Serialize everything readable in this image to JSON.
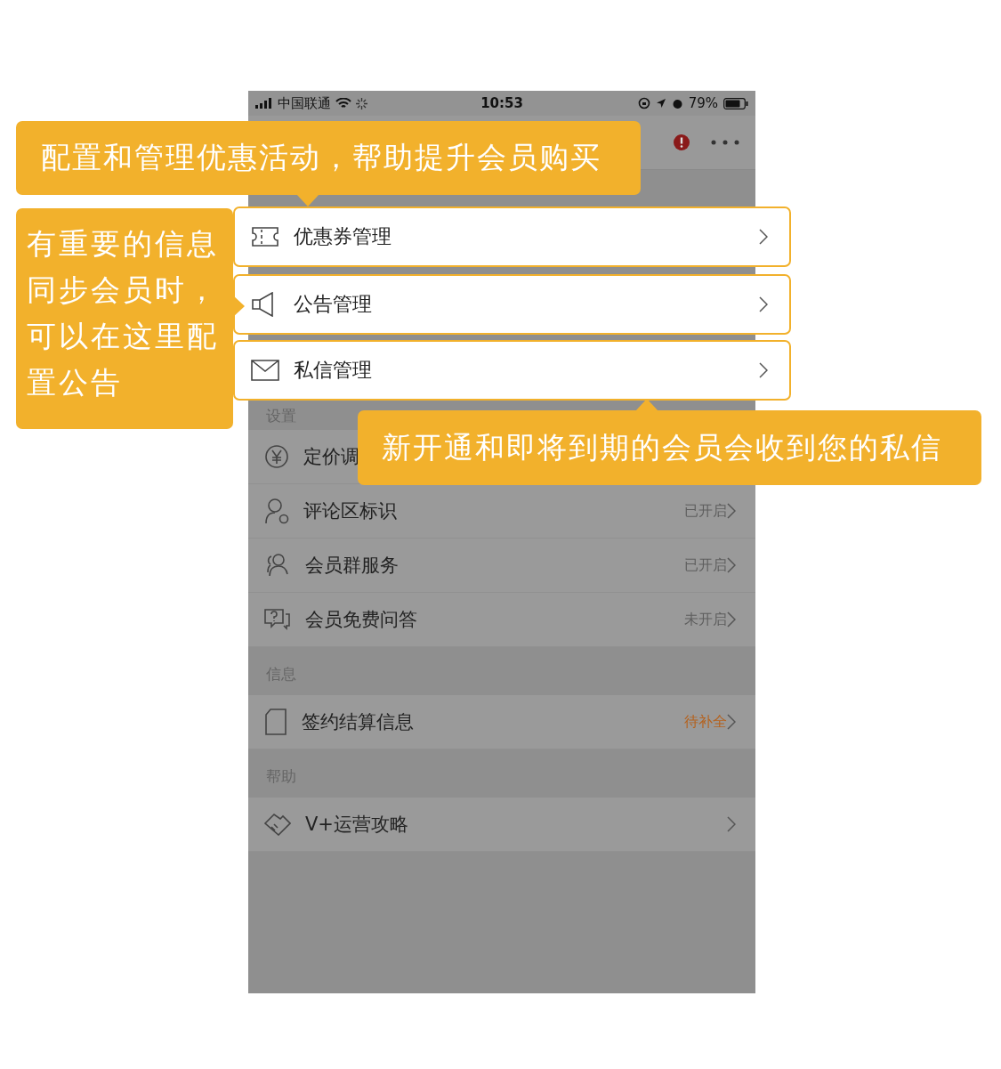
{
  "status_bar": {
    "carrier": "中国联通",
    "time": "10:53",
    "battery": "79%"
  },
  "highlighted_items": [
    {
      "kind": "coupon",
      "label": "优惠券管理"
    },
    {
      "kind": "announcement",
      "label": "公告管理"
    },
    {
      "kind": "message",
      "label": "私信管理"
    }
  ],
  "sections": [
    {
      "title": "设置",
      "items": [
        {
          "kind": "price",
          "label": "定价调"
        },
        {
          "kind": "comment",
          "label": "评论区标识",
          "status": "已开启",
          "attention": false
        },
        {
          "kind": "group",
          "label": "会员群服务",
          "status": "已开启",
          "attention": false
        },
        {
          "kind": "qa",
          "label": "会员免费问答",
          "status": "未开启",
          "attention": false
        }
      ]
    },
    {
      "title": "信息",
      "items": [
        {
          "kind": "document",
          "label": "签约结算信息",
          "status": "待补全",
          "attention": true
        }
      ]
    },
    {
      "title": "帮助",
      "items": [
        {
          "kind": "handshake",
          "label": "V+运营攻略"
        }
      ]
    }
  ],
  "callouts": [
    {
      "text": "配置和管理优惠活动，帮助提升会员购买"
    },
    {
      "text": "有重要的信息同步会员时，可以在这里配置公告"
    },
    {
      "text": "新开通和即将到期的会员会收到您的私信"
    }
  ]
}
